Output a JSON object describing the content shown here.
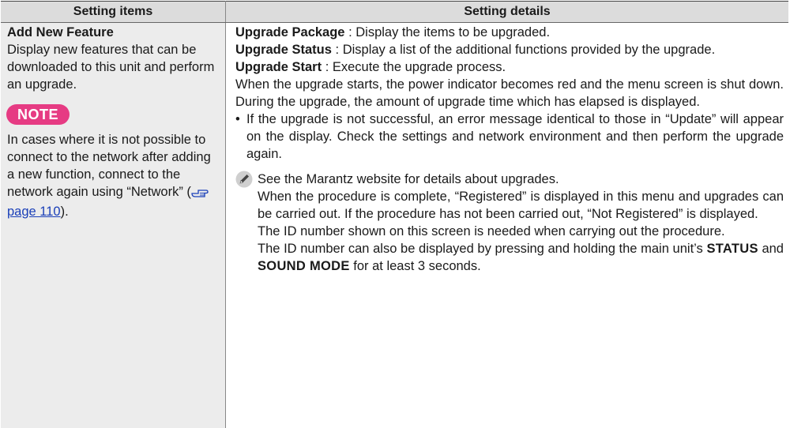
{
  "table": {
    "header_items": "Setting items",
    "header_details": "Setting details"
  },
  "left": {
    "title": "Add New Feature",
    "description": "Display new features that can be downloaded to this unit and perform an upgrade.",
    "note_label": "NOTE",
    "note_text_before": "In cases where it is not possible to connect to the network after adding a new function, connect to the network again using “Network” (",
    "note_link": "page 110",
    "note_text_after": ")."
  },
  "right": {
    "pkg_label": "Upgrade Package",
    "pkg_text": " : Display the items to be upgraded.",
    "status_label": "Upgrade Status",
    "status_text": " : Display a list of the additional functions provided by the upgrade.",
    "start_label": "Upgrade Start",
    "start_text": " : Execute the upgrade process.",
    "start_para": "When the upgrade starts, the power indicator becomes red and the menu screen is shut down. During the upgrade, the amount of upgrade time which has elapsed is displayed.",
    "bullet_mark": "•",
    "bullet": "If the upgrade is not successful, an error message identical to those in “Update” will appear on the display. Check the settings and network environment and then perform the upgrade again.",
    "memo_1": "See the Marantz website for details about upgrades.",
    "memo_2": "When the procedure is complete, “Registered” is displayed in this menu and upgrades can be carried out. If the procedure has not been carried out, “Not Registered” is displayed.",
    "memo_3": "The ID number shown on this screen is needed when carrying out the procedure.",
    "memo_4_before": "The ID number can also be displayed by pressing and holding the main unit’s ",
    "memo_4_key1": "STATUS",
    "memo_4_and": " and ",
    "memo_4_key2": "SOUND MODE",
    "memo_4_after": " for at least 3 seconds."
  }
}
